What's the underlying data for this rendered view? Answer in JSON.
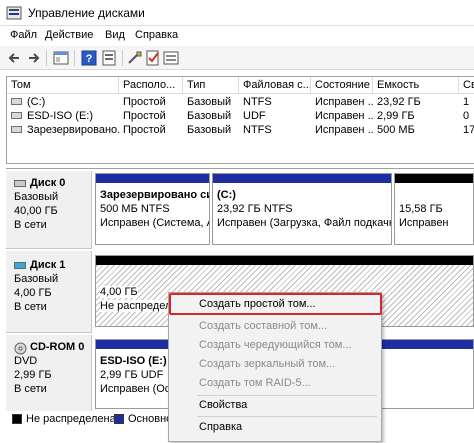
{
  "window": {
    "title": "Управление дисками"
  },
  "menu": [
    "Файл",
    "Действие",
    "Вид",
    "Справка"
  ],
  "volumes": {
    "columns": [
      "Том",
      "Располо...",
      "Тип",
      "Файловая с...",
      "Состояние",
      "Емкость",
      "Св"
    ],
    "rows": [
      [
        "(C:)",
        "Простой",
        "Базовый",
        "NTFS",
        "Исправен ...",
        "23,92 ГБ",
        "1"
      ],
      [
        "ESD-ISO (E:)",
        "Простой",
        "Базовый",
        "UDF",
        "Исправен ...",
        "2,99 ГБ",
        "0"
      ],
      [
        "Зарезервировано...",
        "Простой",
        "Базовый",
        "NTFS",
        "Исправен ...",
        "500 МБ",
        "17"
      ]
    ]
  },
  "disks": [
    {
      "name": "Диск 0",
      "lines": [
        "Базовый",
        "40,00 ГБ",
        "В сети"
      ],
      "partitions": [
        {
          "name": "Зарезервировано си",
          "lines": [
            "500 МБ NTFS",
            "Исправен (Система, А"
          ]
        },
        {
          "name": "(C:)",
          "lines": [
            "23,92 ГБ NTFS",
            "Исправен (Загрузка, Файл подкачки,"
          ]
        },
        {
          "name": "",
          "lines": [
            "15,58 ГБ",
            "Исправен"
          ]
        }
      ]
    },
    {
      "name": "Диск 1",
      "lines": [
        "Базовый",
        "4,00 ГБ",
        "В сети"
      ],
      "partitions": [
        {
          "name": "",
          "lines": [
            "4,00 ГБ",
            "Не распредел"
          ]
        }
      ]
    },
    {
      "name": "CD-ROM 0",
      "lines": [
        "DVD",
        "2,99 ГБ",
        "В сети"
      ],
      "partitions": [
        {
          "name": "ESD-ISO (E:)",
          "lines": [
            "2,99 ГБ UDF",
            "Исправен (Основной"
          ]
        }
      ]
    }
  ],
  "legend": [
    "Не распределена",
    "Основной"
  ],
  "context_menu": {
    "items": [
      {
        "label": "Создать простой том...",
        "enabled": true
      },
      {
        "label": "Создать составной том...",
        "enabled": false
      },
      {
        "label": "Создать чередующийся том...",
        "enabled": false
      },
      {
        "label": "Создать зеркальный том...",
        "enabled": false
      },
      {
        "label": "Создать том RAID-5...",
        "enabled": false
      },
      {
        "label": "Свойства",
        "enabled": true
      },
      {
        "label": "Справка",
        "enabled": true
      }
    ]
  },
  "colors": {
    "primary_partition": "#1c2ea0",
    "unallocated": "#000000",
    "highlight": "#d7262e"
  }
}
